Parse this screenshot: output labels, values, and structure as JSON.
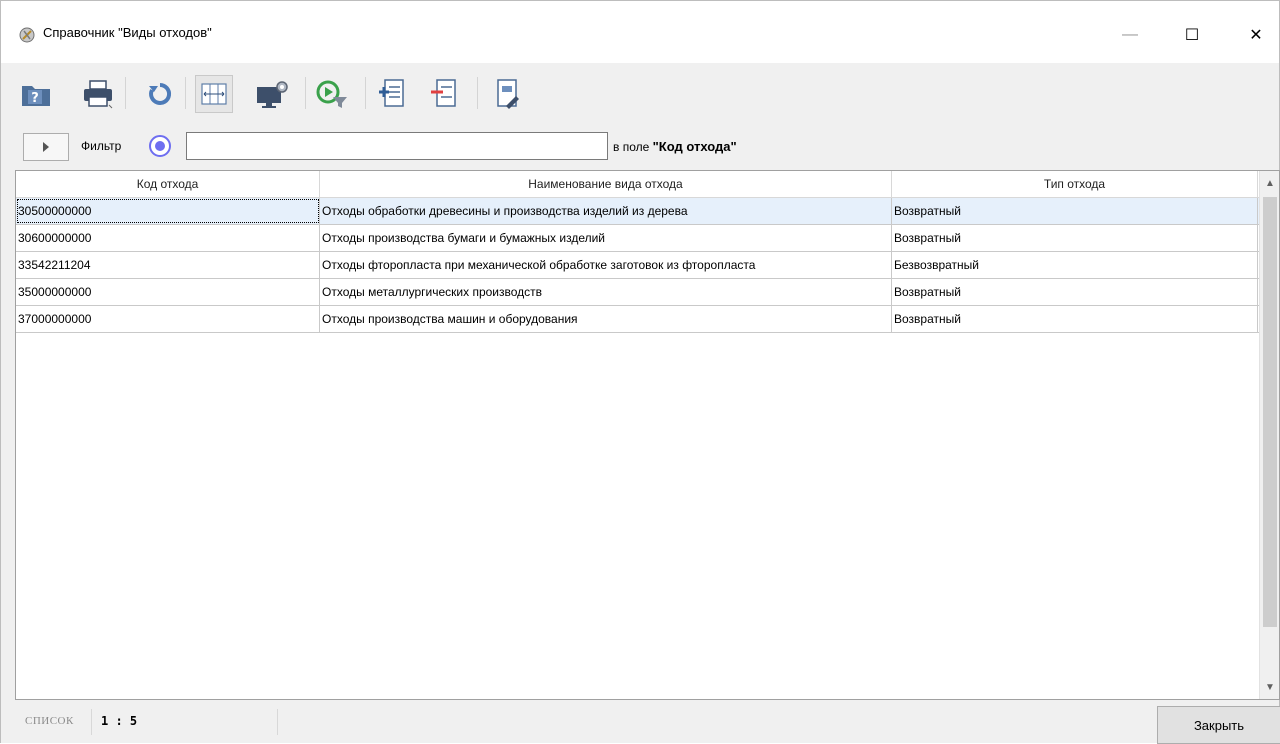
{
  "window": {
    "title": "Справочник \"Виды отходов\"",
    "minimize_glyph": "—",
    "maximize_glyph": "☐",
    "close_glyph": "✕"
  },
  "toolbar": {
    "buttons": [
      {
        "icon": "help-folder-icon"
      },
      {
        "icon": "printer-icon"
      },
      {
        "icon": "refresh-icon"
      },
      {
        "icon": "fit-columns-icon",
        "pressed": true
      },
      {
        "icon": "monitor-settings-icon"
      },
      {
        "icon": "run-filter-icon"
      },
      {
        "icon": "add-record-icon"
      },
      {
        "icon": "delete-record-icon"
      },
      {
        "icon": "edit-record-icon"
      }
    ]
  },
  "filter": {
    "label": "Фильтр",
    "value": "",
    "field_caption_prefix": "в поле",
    "field_caption_name": "\"Код отхода\""
  },
  "grid": {
    "columns": [
      "Код отхода",
      "Наименование вида отхода",
      "Тип отхода"
    ],
    "rows": [
      {
        "code": "30500000000",
        "name": "Отходы обработки древесины и производства изделий из дерева",
        "type": "Возвратный"
      },
      {
        "code": "30600000000",
        "name": "Отходы производства бумаги и бумажных изделий",
        "type": "Возвратный"
      },
      {
        "code": "33542211204",
        "name": "Отходы фторопласта при механической обработке заготовок из фторопласта",
        "type": "Безвозвратный"
      },
      {
        "code": "35000000000",
        "name": "Отходы металлургических производств",
        "type": "Возвратный"
      },
      {
        "code": "37000000000",
        "name": "Отходы производства машин и оборудования",
        "type": "Возвратный"
      }
    ]
  },
  "status": {
    "mode_label": "СПИСОК",
    "position": "1 : 5"
  },
  "footer": {
    "close_label": "Закрыть"
  },
  "colors": {
    "selected_row": "#e6f0fb",
    "radio_accent": "#6e6ef0"
  }
}
